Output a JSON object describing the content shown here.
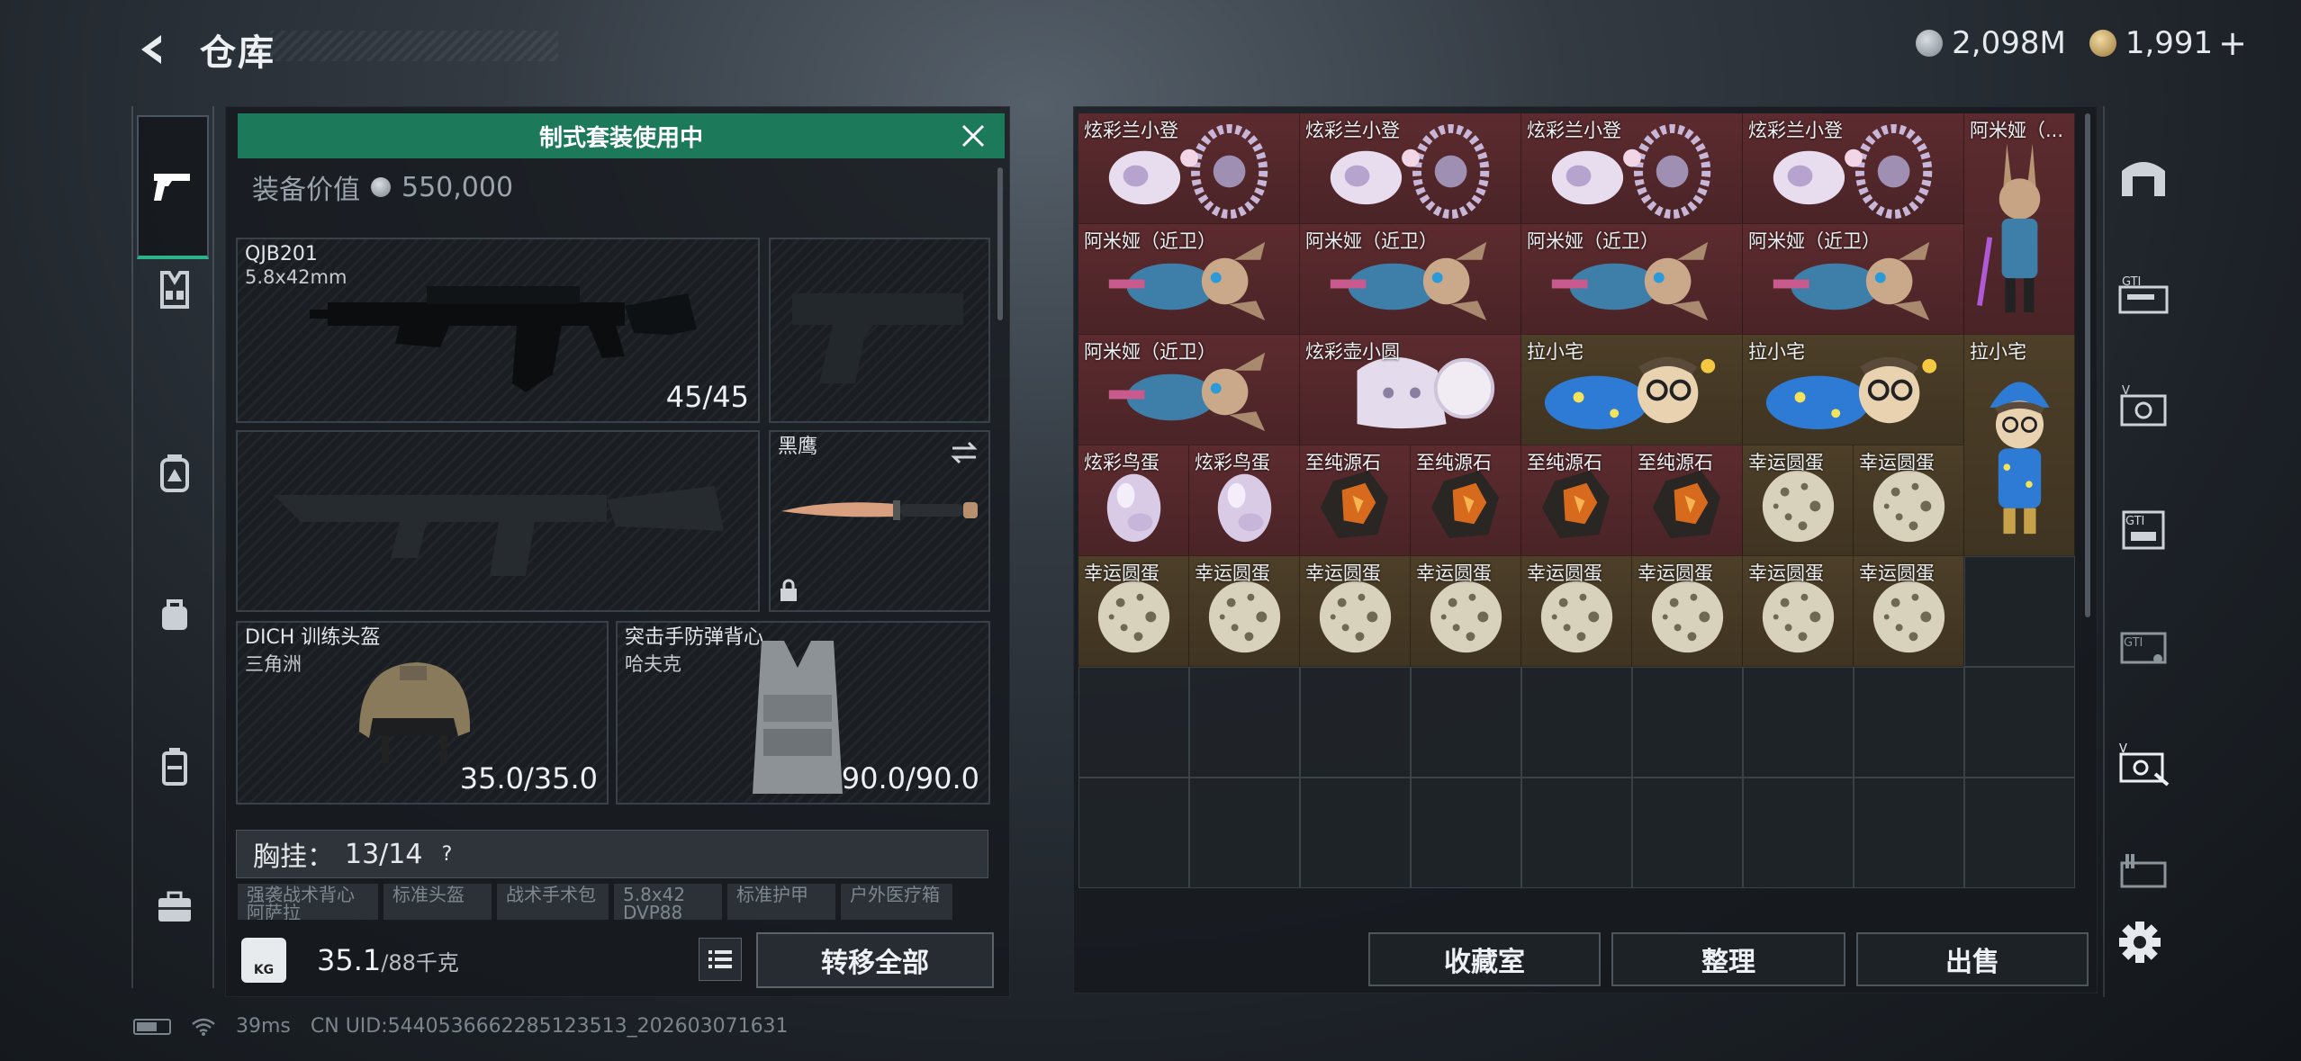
{
  "header": {
    "title": "仓库"
  },
  "currency": [
    {
      "icon": "silver-coin-icon",
      "value": "2,098M"
    },
    {
      "icon": "gold-triangle-coin-icon",
      "value": "1,991"
    }
  ],
  "currency_add_label": "+",
  "loadout": {
    "banner": "制式套装使用中",
    "equip_value_label": "装备价值",
    "equip_value": "550,000",
    "primary_weapon": {
      "name": "QJB201",
      "caliber": "5.8x42mm",
      "ammo": "45/45"
    },
    "melee": {
      "name": "黑鹰"
    },
    "helmet": {
      "name": "DICH 训练头盔",
      "sub": "三角洲",
      "durability": "35.0/35.0"
    },
    "armor": {
      "name": "突击手防弹背心",
      "sub": "哈夫克",
      "durability": "90.0/90.0"
    },
    "chest_rig": {
      "label": "胸挂：",
      "value": "13/14",
      "help": "?"
    },
    "chips": [
      "强袭战术背心\n阿萨拉",
      "标准头盔",
      "战术手术包",
      "5.8x42\nDVP88",
      "标准护甲",
      "户外医疗箱"
    ],
    "weight": {
      "value": "35.1",
      "max": "/88千克",
      "icon_label": "KG"
    },
    "transfer_all": "转移全部"
  },
  "stash": {
    "items": [
      {
        "name": "炫彩兰小登",
        "kind": "cloth",
        "bg": "red"
      },
      {
        "name": "炫彩兰小登",
        "kind": "cloth",
        "bg": "red"
      },
      {
        "name": "炫彩兰小登",
        "kind": "cloth",
        "bg": "red"
      },
      {
        "name": "炫彩兰小登",
        "kind": "cloth",
        "bg": "red"
      },
      {
        "name": "阿米娅（...",
        "kind": "figure",
        "bg": "red"
      },
      {
        "name": "阿米娅（近卫）",
        "kind": "bunny",
        "bg": "red"
      },
      {
        "name": "阿米娅（近卫）",
        "kind": "bunny",
        "bg": "red"
      },
      {
        "name": "阿米娅（近卫）",
        "kind": "bunny",
        "bg": "red"
      },
      {
        "name": "阿米娅（近卫）",
        "kind": "bunny",
        "bg": "red"
      },
      {
        "name": "阿米娅（近卫）",
        "kind": "bunny",
        "bg": "red"
      },
      {
        "name": "炫彩壶小圆",
        "kind": "ghost",
        "bg": "red"
      },
      {
        "name": "拉小宅",
        "kind": "plush",
        "bg": "gold"
      },
      {
        "name": "拉小宅",
        "kind": "plush",
        "bg": "gold"
      },
      {
        "name": "拉小宅",
        "kind": "figure2",
        "bg": "gold"
      },
      {
        "name": "炫彩鸟蛋",
        "kind": "egg",
        "bg": "red"
      },
      {
        "name": "炫彩鸟蛋",
        "kind": "egg",
        "bg": "red"
      },
      {
        "name": "至纯源石",
        "kind": "stone",
        "bg": "red"
      },
      {
        "name": "至纯源石",
        "kind": "stone",
        "bg": "red"
      },
      {
        "name": "至纯源石",
        "kind": "stone",
        "bg": "red"
      },
      {
        "name": "至纯源石",
        "kind": "stone",
        "bg": "red"
      },
      {
        "name": "幸运圆蛋",
        "kind": "round",
        "bg": "gold"
      },
      {
        "name": "幸运圆蛋",
        "kind": "round",
        "bg": "gold"
      },
      {
        "name": "幸运圆蛋",
        "kind": "round",
        "bg": "gold"
      },
      {
        "name": "幸运圆蛋",
        "kind": "round",
        "bg": "gold"
      },
      {
        "name": "幸运圆蛋",
        "kind": "round",
        "bg": "gold"
      },
      {
        "name": "幸运圆蛋",
        "kind": "round",
        "bg": "gold"
      },
      {
        "name": "幸运圆蛋",
        "kind": "round",
        "bg": "gold"
      },
      {
        "name": "幸运圆蛋",
        "kind": "round",
        "bg": "gold"
      },
      {
        "name": "幸运圆蛋",
        "kind": "round",
        "bg": "gold"
      },
      {
        "name": "幸运圆蛋",
        "kind": "round",
        "bg": "gold"
      }
    ],
    "buttons": {
      "collection": "收藏室",
      "sort": "整理",
      "sell": "出售"
    }
  },
  "right_nav": [
    "shelter-icon",
    "gti-box-icon",
    "vault-icon",
    "gti-safe-icon",
    "gti-crate-icon",
    "vault-tool-icon",
    "gun-case-icon",
    "settings-gear-icon"
  ],
  "left_nav": [
    "pistol-icon",
    "chest-rig-icon",
    "backpack-icon",
    "bag-icon",
    "case-icon",
    "briefcase-icon"
  ],
  "status": {
    "ping": "39ms",
    "uid": "CN UID:5440536662285123513_202603071631"
  },
  "colors": {
    "accent_green": "#1c7a5a",
    "rarity_red": "#5a2a2e",
    "rarity_gold": "#4a3c26"
  }
}
